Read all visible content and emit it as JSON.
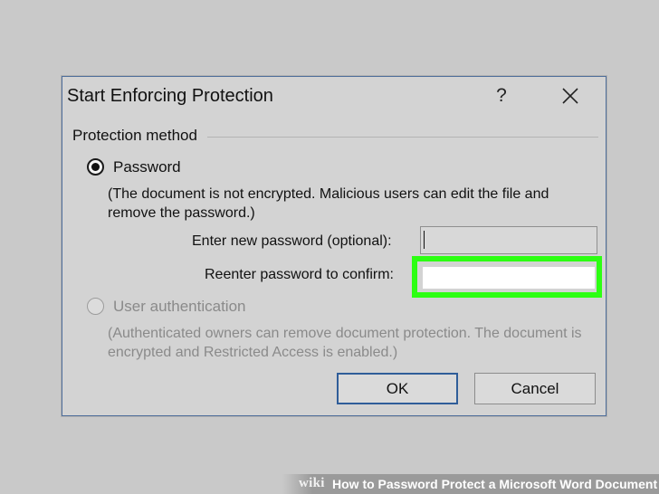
{
  "dialog": {
    "title": "Start Enforcing Protection",
    "help_label": "?",
    "close_icon": "close-icon",
    "group_label": "Protection method",
    "password_option": {
      "label": "Password",
      "selected": true,
      "description": "(The document is not encrypted. Malicious users can edit the file and remove the password.)"
    },
    "new_password": {
      "label": "Enter new password (optional):",
      "value": ""
    },
    "confirm_password": {
      "label": "Reenter password to confirm:",
      "value": "",
      "highlight_color": "#2cff12"
    },
    "user_auth_option": {
      "label": "User authentication",
      "selected": false,
      "disabled": true,
      "description": "(Authenticated owners can remove document protection. The document is encrypted and Restricted Access is enabled.)"
    },
    "ok_label": "OK",
    "cancel_label": "Cancel"
  },
  "caption": {
    "brand": "wiki",
    "text": "How to Password Protect a Microsoft Word Document"
  },
  "colors": {
    "background": "#c9c9c9",
    "dialog_bg": "#d3d3d3",
    "dialog_border": "#4f6f9c",
    "ok_border": "#2f5d99",
    "highlight": "#2cff12"
  }
}
